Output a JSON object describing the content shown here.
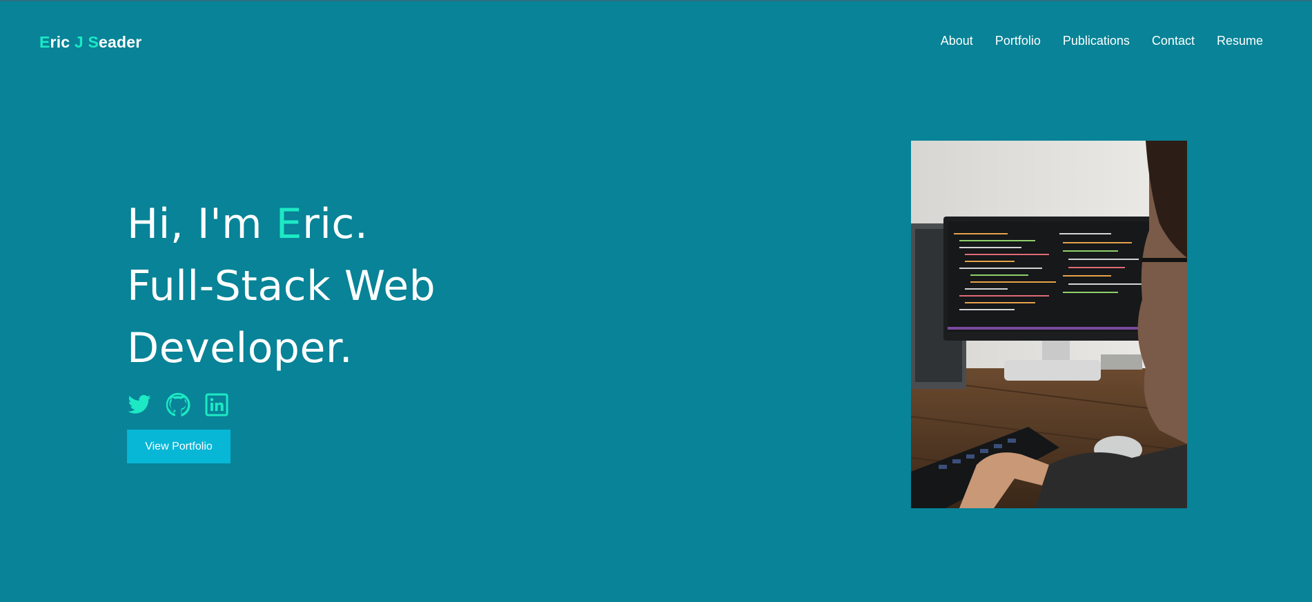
{
  "logo": {
    "e": "E",
    "ric": "ric ",
    "j": "J",
    "s": "S",
    "eader": "eader"
  },
  "nav": {
    "about": "About",
    "portfolio": "Portfolio",
    "publications": "Publications",
    "contact": "Contact",
    "resume": "Resume"
  },
  "hero": {
    "greeting_prefix": "Hi, I'm ",
    "name_initial": "E",
    "name_rest": "ric.",
    "line2": "Full-Stack Web",
    "line3": "Developer."
  },
  "socials": [
    "twitter-icon",
    "github-icon",
    "linkedin-icon"
  ],
  "button": {
    "view_portfolio": "View Portfolio"
  },
  "colors": {
    "background": "#088397",
    "accent": "#1de9c4",
    "button": "#08b6d6",
    "text": "#ffffff"
  }
}
